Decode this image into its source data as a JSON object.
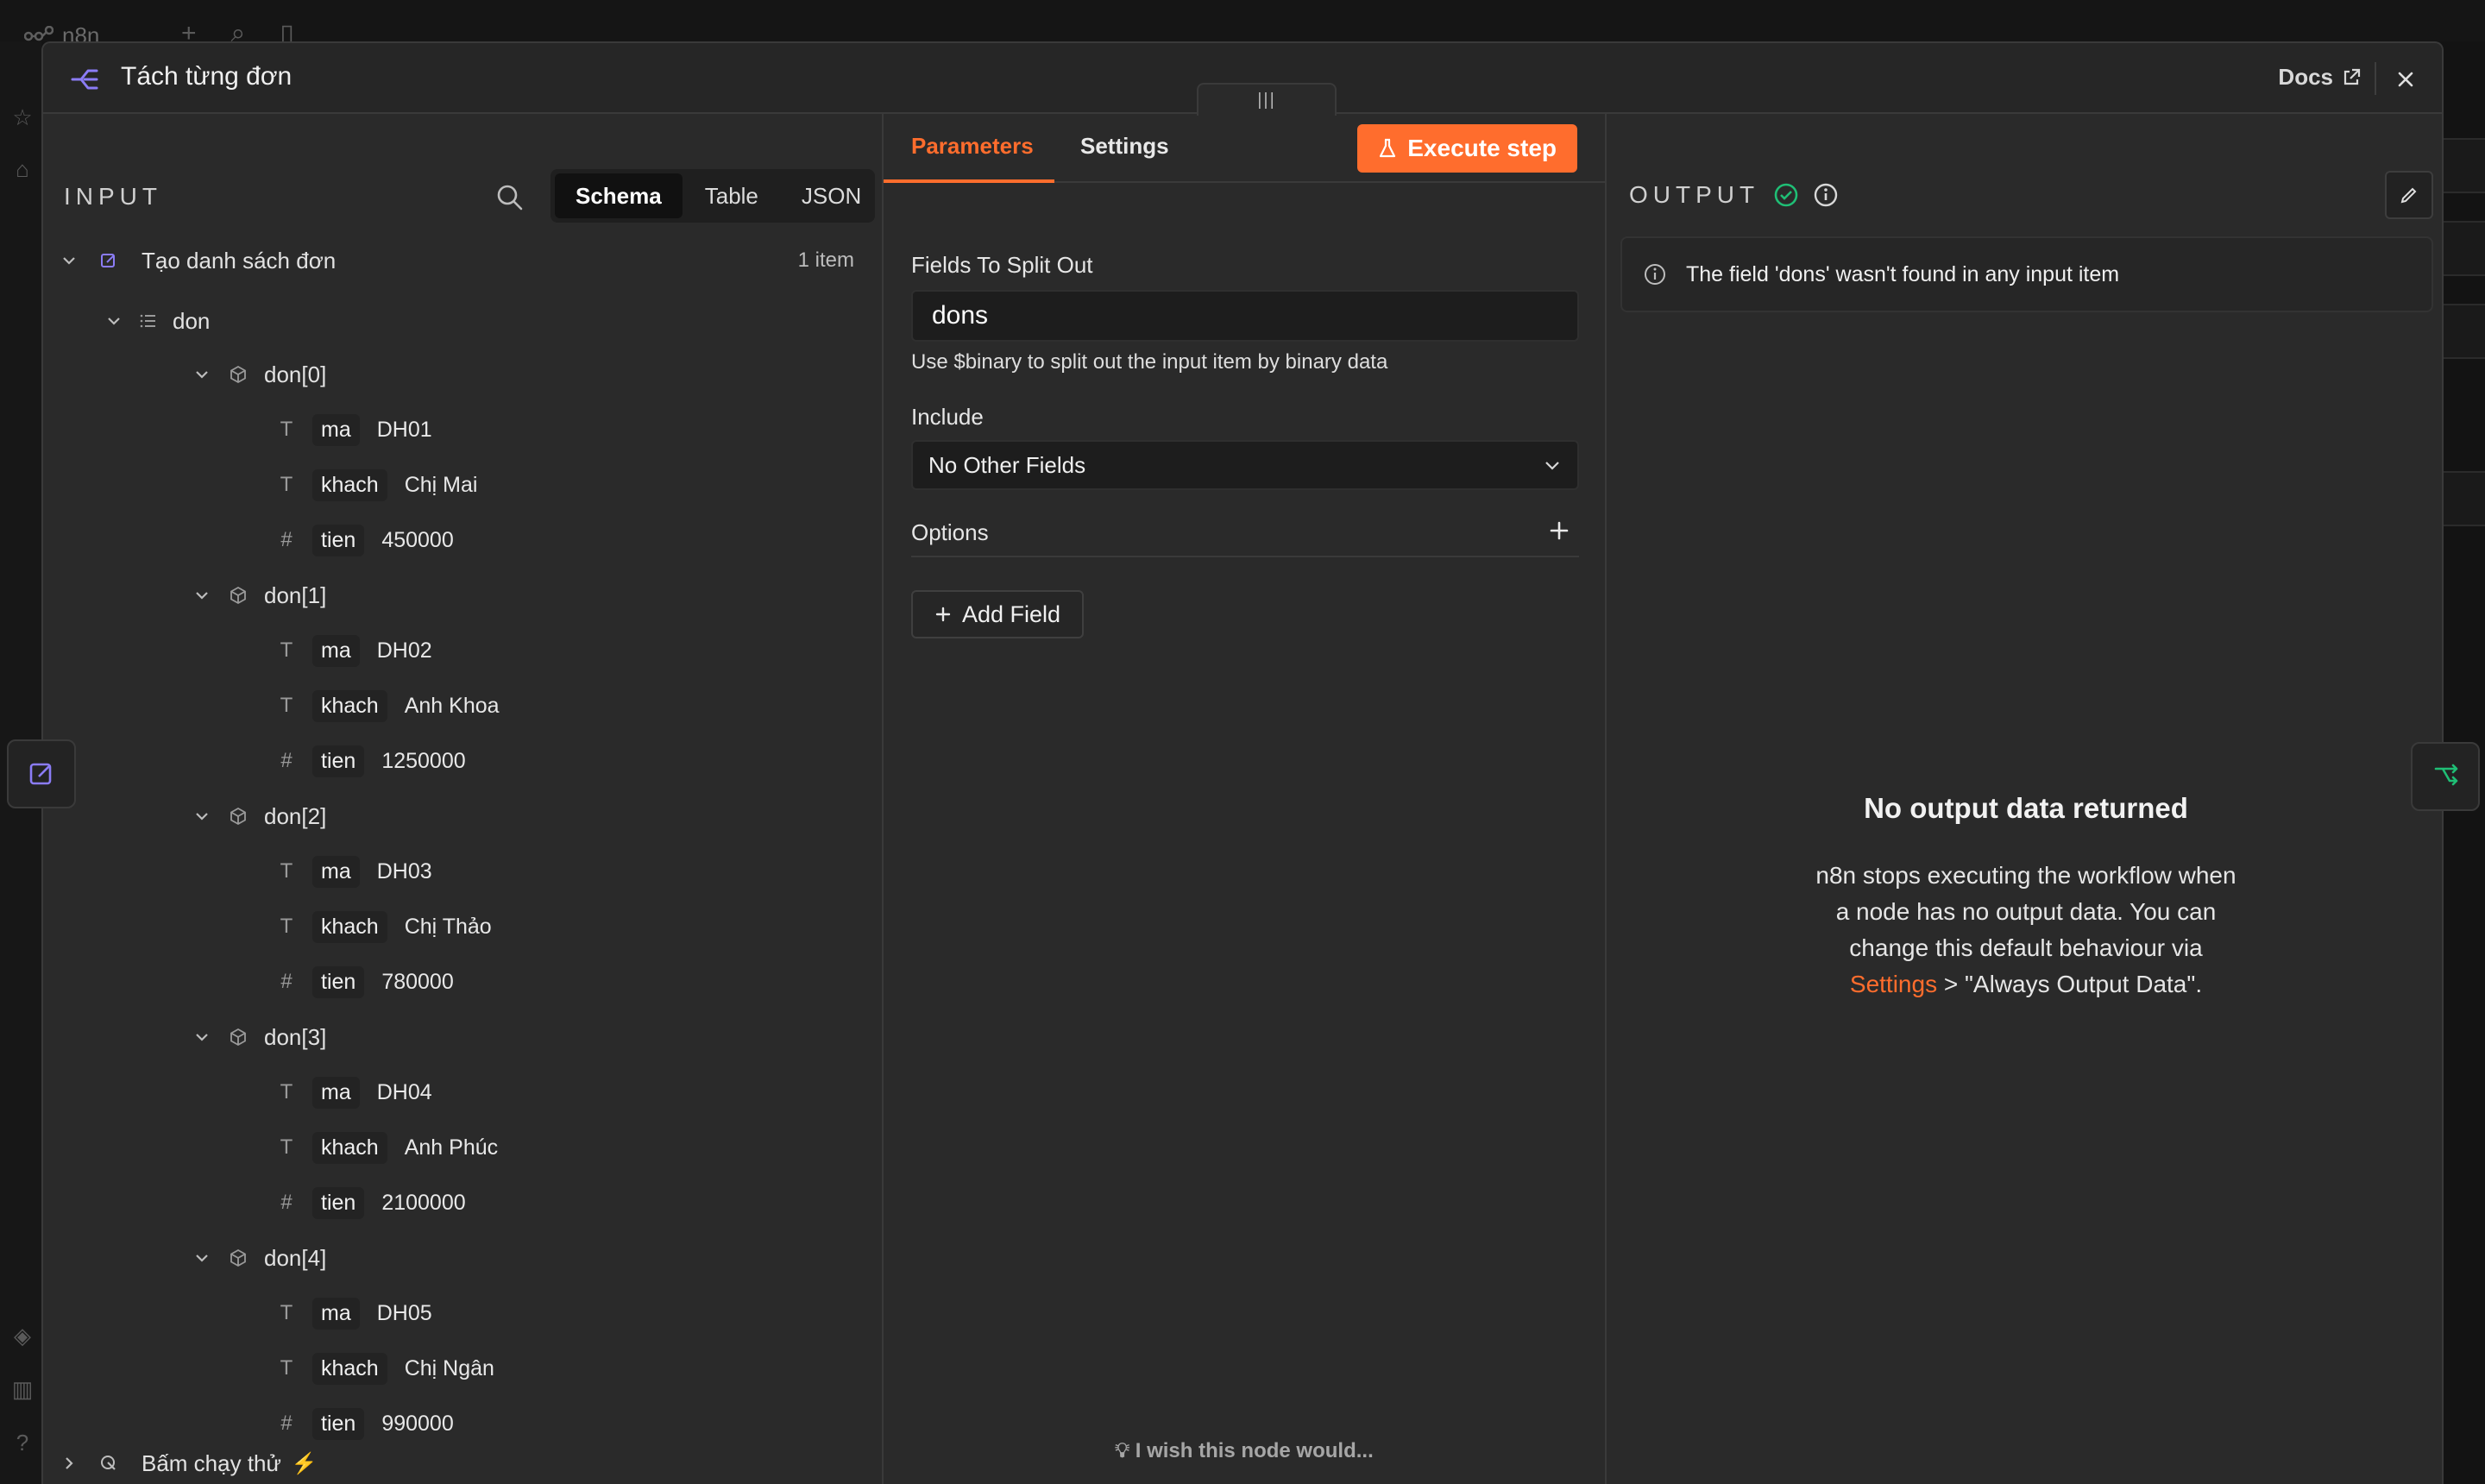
{
  "background": {
    "app_name": "n8n"
  },
  "modal": {
    "title": "Tách từng đơn",
    "docs_label": "Docs"
  },
  "input": {
    "label": "INPUT",
    "view_tabs": [
      "Schema",
      "Table",
      "JSON"
    ],
    "active_view": "Schema",
    "source_node": "Tạo danh sách đơn",
    "item_count": "1 item",
    "root_field": "don",
    "groups": [
      {
        "name": "don[0]",
        "fields": [
          {
            "type": "T",
            "key": "ma",
            "value": "DH01"
          },
          {
            "type": "T",
            "key": "khach",
            "value": "Chị Mai"
          },
          {
            "type": "#",
            "key": "tien",
            "value": "450000"
          }
        ]
      },
      {
        "name": "don[1]",
        "fields": [
          {
            "type": "T",
            "key": "ma",
            "value": "DH02"
          },
          {
            "type": "T",
            "key": "khach",
            "value": "Anh Khoa"
          },
          {
            "type": "#",
            "key": "tien",
            "value": "1250000"
          }
        ]
      },
      {
        "name": "don[2]",
        "fields": [
          {
            "type": "T",
            "key": "ma",
            "value": "DH03"
          },
          {
            "type": "T",
            "key": "khach",
            "value": "Chị Thảo"
          },
          {
            "type": "#",
            "key": "tien",
            "value": "780000"
          }
        ]
      },
      {
        "name": "don[3]",
        "fields": [
          {
            "type": "T",
            "key": "ma",
            "value": "DH04"
          },
          {
            "type": "T",
            "key": "khach",
            "value": "Anh Phúc"
          },
          {
            "type": "#",
            "key": "tien",
            "value": "2100000"
          }
        ]
      },
      {
        "name": "don[4]",
        "fields": [
          {
            "type": "T",
            "key": "ma",
            "value": "DH05"
          },
          {
            "type": "T",
            "key": "khach",
            "value": "Chị Ngân"
          },
          {
            "type": "#",
            "key": "tien",
            "value": "990000"
          }
        ]
      }
    ],
    "other_node": "Bấm chạy thử"
  },
  "params": {
    "tabs": [
      "Parameters",
      "Settings"
    ],
    "active_tab": "Parameters",
    "execute_label": "Execute step",
    "fields_label": "Fields To Split Out",
    "fields_value": "dons",
    "fields_hint": "Use $binary to split out the input item by binary data",
    "include_label": "Include",
    "include_value": "No Other Fields",
    "options_label": "Options",
    "add_field_label": "Add Field",
    "wish_label": "I wish this node would..."
  },
  "output": {
    "label": "OUTPUT",
    "notice": "The field 'dons' wasn't found in any input item",
    "empty_title": "No output data returned",
    "empty_text_1": "n8n stops executing the workflow when a node has no output data. You can change this default behaviour via ",
    "empty_link": "Settings",
    "empty_text_2": " > \"Always Output Data\"."
  },
  "colors": {
    "accent": "#ff6d2d",
    "success": "#1fbe75",
    "node_purple": "#8b7cf6",
    "panel_bg": "#2a2a2a"
  }
}
